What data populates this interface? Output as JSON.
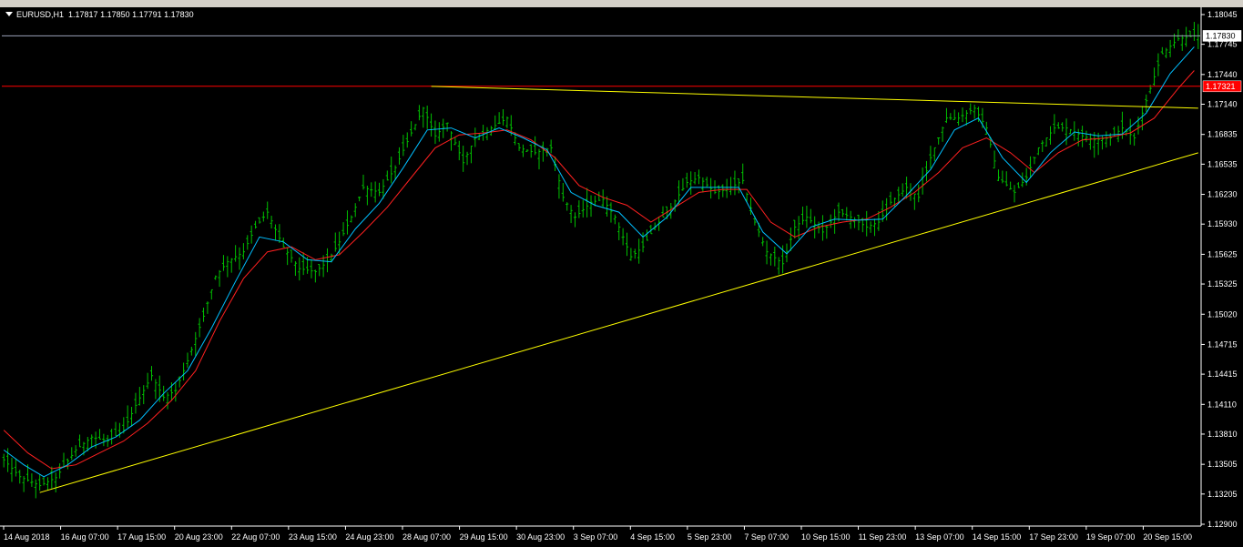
{
  "window": {
    "symbol_label": "EURUSD,H1",
    "ohlc_label": "1.17817 1.17850 1.17791 1.17830"
  },
  "colors": {
    "background": "#000000",
    "bars": "#00c000",
    "fast_ma": "#00bfff",
    "slow_ma": "#ff2020",
    "trendline": "#ffff00",
    "resistance": "#ff0000",
    "bid_line": "#9aa0b8",
    "axis_text": "#ffffff"
  },
  "chart_data": {
    "type": "line",
    "ylim": [
      1.129,
      1.18045
    ],
    "y_ticks": [
      "1.18045",
      "1.17745",
      "1.17440",
      "1.17140",
      "1.16835",
      "1.16535",
      "1.16230",
      "1.15930",
      "1.15625",
      "1.15325",
      "1.15020",
      "1.14715",
      "1.14415",
      "1.14110",
      "1.13810",
      "1.13505",
      "1.13205",
      "1.12900"
    ],
    "x_ticks": [
      "14 Aug 2018",
      "16 Aug 07:00",
      "17 Aug 15:00",
      "20 Aug 23:00",
      "22 Aug 07:00",
      "23 Aug 15:00",
      "24 Aug 23:00",
      "28 Aug 07:00",
      "29 Aug 15:00",
      "30 Aug 23:00",
      "3 Sep 07:00",
      "4 Sep 15:00",
      "5 Sep 23:00",
      "7 Sep 07:00",
      "10 Sep 15:00",
      "11 Sep 23:00",
      "13 Sep 07:00",
      "14 Sep 15:00",
      "17 Sep 23:00",
      "19 Sep 07:00",
      "20 Sep 15:00"
    ],
    "price_labels": {
      "bid": "1.17830",
      "resistance": "1.17321"
    },
    "horizontal_levels": {
      "bid": 1.1783,
      "resistance": 1.17321
    },
    "path_points": [
      [
        0,
        1.1355
      ],
      [
        4,
        1.1338
      ],
      [
        9,
        1.1329
      ],
      [
        13,
        1.1337
      ],
      [
        18,
        1.1365
      ],
      [
        22,
        1.1378
      ],
      [
        26,
        1.1374
      ],
      [
        30,
        1.1385
      ],
      [
        33,
        1.141
      ],
      [
        37,
        1.144
      ],
      [
        40,
        1.1418
      ],
      [
        43,
        1.1425
      ],
      [
        46,
        1.1455
      ],
      [
        50,
        1.15
      ],
      [
        53,
        1.154
      ],
      [
        56,
        1.1555
      ],
      [
        60,
        1.1565
      ],
      [
        63,
        1.159
      ],
      [
        66,
        1.1605
      ],
      [
        70,
        1.157
      ],
      [
        74,
        1.1548
      ],
      [
        78,
        1.1545
      ],
      [
        81,
        1.1555
      ],
      [
        84,
        1.1575
      ],
      [
        87,
        1.16
      ],
      [
        90,
        1.163
      ],
      [
        94,
        1.1625
      ],
      [
        98,
        1.165
      ],
      [
        102,
        1.1685
      ],
      [
        105,
        1.171
      ],
      [
        108,
        1.1682
      ],
      [
        111,
        1.1695
      ],
      [
        115,
        1.1655
      ],
      [
        118,
        1.168
      ],
      [
        122,
        1.169
      ],
      [
        126,
        1.17
      ],
      [
        129,
        1.167
      ],
      [
        133,
        1.1665
      ],
      [
        137,
        1.167
      ],
      [
        140,
        1.162
      ],
      [
        143,
        1.16
      ],
      [
        147,
        1.1615
      ],
      [
        150,
        1.1618
      ],
      [
        153,
        1.16
      ],
      [
        157,
        1.156
      ],
      [
        160,
        1.157
      ],
      [
        163,
        1.159
      ],
      [
        167,
        1.161
      ],
      [
        171,
        1.1635
      ],
      [
        174,
        1.164
      ],
      [
        178,
        1.1625
      ],
      [
        181,
        1.1628
      ],
      [
        185,
        1.1637
      ],
      [
        188,
        1.1595
      ],
      [
        191,
        1.1565
      ],
      [
        195,
        1.1553
      ],
      [
        198,
        1.159
      ],
      [
        201,
        1.16
      ],
      [
        205,
        1.1585
      ],
      [
        209,
        1.1605
      ],
      [
        212,
        1.16
      ],
      [
        216,
        1.159
      ],
      [
        219,
        1.1595
      ],
      [
        222,
        1.1615
      ],
      [
        226,
        1.163
      ],
      [
        229,
        1.162
      ],
      [
        232,
        1.166
      ],
      [
        236,
        1.17
      ],
      [
        239,
        1.17
      ],
      [
        243,
        1.171
      ],
      [
        246,
        1.169
      ],
      [
        249,
        1.164
      ],
      [
        253,
        1.1625
      ],
      [
        256,
        1.164
      ],
      [
        259,
        1.167
      ],
      [
        263,
        1.169
      ],
      [
        266,
        1.169
      ],
      [
        270,
        1.1682
      ],
      [
        273,
        1.1678
      ],
      [
        277,
        1.168
      ],
      [
        280,
        1.169
      ],
      [
        283,
        1.168
      ],
      [
        287,
        1.173
      ],
      [
        290,
        1.1765
      ],
      [
        294,
        1.178
      ],
      [
        298,
        1.1783
      ]
    ],
    "fast_ma_points": [
      [
        0,
        1.1365
      ],
      [
        5,
        1.135
      ],
      [
        10,
        1.1338
      ],
      [
        16,
        1.135
      ],
      [
        22,
        1.1368
      ],
      [
        28,
        1.1378
      ],
      [
        34,
        1.1395
      ],
      [
        40,
        1.1422
      ],
      [
        46,
        1.1445
      ],
      [
        52,
        1.1488
      ],
      [
        58,
        1.1535
      ],
      [
        64,
        1.158
      ],
      [
        70,
        1.1575
      ],
      [
        76,
        1.1557
      ],
      [
        82,
        1.1555
      ],
      [
        88,
        1.1588
      ],
      [
        94,
        1.1614
      ],
      [
        100,
        1.165
      ],
      [
        106,
        1.1688
      ],
      [
        112,
        1.169
      ],
      [
        118,
        1.168
      ],
      [
        124,
        1.169
      ],
      [
        130,
        1.168
      ],
      [
        136,
        1.1668
      ],
      [
        142,
        1.1625
      ],
      [
        148,
        1.1612
      ],
      [
        154,
        1.1605
      ],
      [
        160,
        1.158
      ],
      [
        166,
        1.16
      ],
      [
        172,
        1.163
      ],
      [
        178,
        1.163
      ],
      [
        184,
        1.163
      ],
      [
        190,
        1.1585
      ],
      [
        196,
        1.1563
      ],
      [
        202,
        1.159
      ],
      [
        208,
        1.1598
      ],
      [
        214,
        1.1597
      ],
      [
        220,
        1.1598
      ],
      [
        226,
        1.1622
      ],
      [
        232,
        1.1648
      ],
      [
        238,
        1.1688
      ],
      [
        244,
        1.17
      ],
      [
        250,
        1.166
      ],
      [
        256,
        1.1635
      ],
      [
        262,
        1.1665
      ],
      [
        268,
        1.1686
      ],
      [
        274,
        1.1682
      ],
      [
        280,
        1.1684
      ],
      [
        286,
        1.1705
      ],
      [
        292,
        1.1745
      ],
      [
        298,
        1.1772
      ]
    ],
    "slow_ma_points": [
      [
        0,
        1.1385
      ],
      [
        6,
        1.1362
      ],
      [
        12,
        1.1346
      ],
      [
        18,
        1.135
      ],
      [
        24,
        1.1362
      ],
      [
        30,
        1.1374
      ],
      [
        36,
        1.1392
      ],
      [
        42,
        1.1415
      ],
      [
        48,
        1.1445
      ],
      [
        54,
        1.1495
      ],
      [
        60,
        1.1538
      ],
      [
        66,
        1.1565
      ],
      [
        72,
        1.157
      ],
      [
        78,
        1.1557
      ],
      [
        84,
        1.1562
      ],
      [
        90,
        1.1585
      ],
      [
        96,
        1.161
      ],
      [
        102,
        1.164
      ],
      [
        108,
        1.167
      ],
      [
        114,
        1.1683
      ],
      [
        120,
        1.1685
      ],
      [
        126,
        1.1688
      ],
      [
        132,
        1.1678
      ],
      [
        138,
        1.166
      ],
      [
        144,
        1.1632
      ],
      [
        150,
        1.162
      ],
      [
        156,
        1.1612
      ],
      [
        162,
        1.1595
      ],
      [
        168,
        1.161
      ],
      [
        174,
        1.1625
      ],
      [
        180,
        1.1628
      ],
      [
        186,
        1.1628
      ],
      [
        192,
        1.1595
      ],
      [
        198,
        1.158
      ],
      [
        204,
        1.159
      ],
      [
        210,
        1.1595
      ],
      [
        216,
        1.1598
      ],
      [
        222,
        1.161
      ],
      [
        228,
        1.1625
      ],
      [
        234,
        1.1645
      ],
      [
        240,
        1.167
      ],
      [
        246,
        1.168
      ],
      [
        252,
        1.1665
      ],
      [
        258,
        1.1645
      ],
      [
        264,
        1.1665
      ],
      [
        270,
        1.1678
      ],
      [
        276,
        1.168
      ],
      [
        282,
        1.1685
      ],
      [
        288,
        1.17
      ],
      [
        294,
        1.173
      ],
      [
        298,
        1.1748
      ]
    ],
    "bar_count": 300,
    "trendlines": [
      {
        "name": "support",
        "from": [
          9,
          1.1322
        ],
        "to": [
          299,
          1.1665
        ]
      },
      {
        "name": "resistance_trend",
        "from": [
          107,
          1.1732
        ],
        "to": [
          299,
          1.171
        ]
      }
    ]
  }
}
